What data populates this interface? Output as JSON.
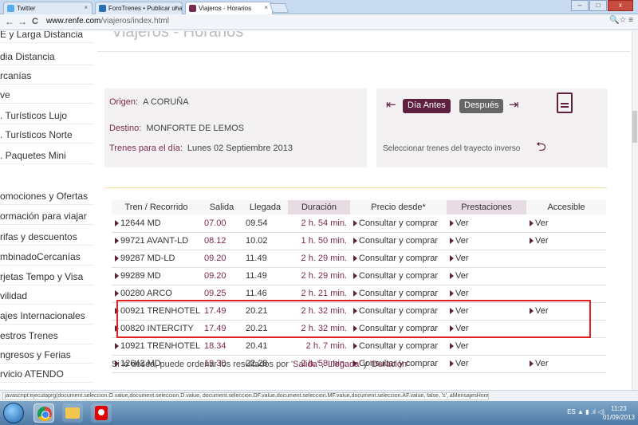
{
  "browser": {
    "tabs": [
      {
        "label": "Twitter",
        "icon": "twitter-icon",
        "color": "#55acee"
      },
      {
        "label": "ForoTrenes • Publicar una",
        "icon": "forum-icon",
        "color": "#2a6fb0"
      },
      {
        "label": "Viajeros - Horarios",
        "icon": "renfe-icon",
        "color": "#7b2a4f"
      }
    ],
    "close_glyph": "×",
    "url_host": "www.renfe.com",
    "url_path": "/viajeros/index.html",
    "back_glyph": "←",
    "forward_glyph": "→",
    "reload_glyph": "C",
    "right_icons": "🔍☆ ≡"
  },
  "page": {
    "heading": "Viajeros - Horarios"
  },
  "sidebar": {
    "items": [
      "E y Larga Distancia",
      "dia Distancia",
      "rcanías",
      "ve",
      ". Turísticos Lujo",
      ". Turísticos Norte",
      ". Paquetes Mini",
      "omociones y Ofertas",
      "ormación para viajar",
      "rifas y descuentos",
      "mbinadoCercanías",
      "rjetas Tempo y Visa",
      "vilidad",
      "ajes Internacionales",
      "estros Trenes",
      "ngresos y Ferias",
      "rvicio ATENDO"
    ]
  },
  "trip": {
    "origin_label": "Origen:",
    "origin": "A CORUÑA",
    "dest_label": "Destino:",
    "dest": "MONFORTE DE LEMOS",
    "date_label": "Trenes para el día:",
    "date": "Lunes  02  Septiembre  2013"
  },
  "daynav": {
    "prev_label": "Día Antes",
    "next_label": "Después",
    "inverse_label": "Seleccionar trenes del trayecto inverso"
  },
  "table": {
    "headers": [
      "Tren / Recorrido",
      "Salida",
      "Llegada",
      "Duración",
      "Precio desde*",
      "Prestaciones",
      "Accesible"
    ],
    "rows": [
      {
        "tren": "12644 MD",
        "salida": "07.00",
        "llegada": "09.54",
        "duracion": "2 h. 54 min.",
        "precio": "Consultar y comprar",
        "prest": "Ver",
        "acc": "Ver"
      },
      {
        "tren": "99721 AVANT-LD",
        "salida": "08.12",
        "llegada": "10.02",
        "duracion": "1 h. 50 min.",
        "precio": "Consultar y comprar",
        "prest": "Ver",
        "acc": "Ver"
      },
      {
        "tren": "99287 MD-LD",
        "salida": "09.20",
        "llegada": "11.49",
        "duracion": "2 h. 29 min.",
        "precio": "Consultar y comprar",
        "prest": "Ver",
        "acc": ""
      },
      {
        "tren": "99289 MD",
        "salida": "09.20",
        "llegada": "11.49",
        "duracion": "2 h. 29 min.",
        "precio": "Consultar y comprar",
        "prest": "Ver",
        "acc": ""
      },
      {
        "tren": "00280 ARCO",
        "salida": "09.25",
        "llegada": "11.46",
        "duracion": "2 h. 21 min.",
        "precio": "Consultar y comprar",
        "prest": "Ver",
        "acc": ""
      },
      {
        "tren": "00921 TRENHOTEL",
        "salida": "17.49",
        "llegada": "20.21",
        "duracion": "2 h. 32 min.",
        "precio": "Consultar y comprar",
        "prest": "Ver",
        "acc": "Ver"
      },
      {
        "tren": "00820 INTERCITY",
        "salida": "17.49",
        "llegada": "20.21",
        "duracion": "2 h. 32 min.",
        "precio": "Consultar y comprar",
        "prest": "Ver",
        "acc": ""
      },
      {
        "tren": "10921 TRENHOTEL",
        "salida": "18.34",
        "llegada": "20.41",
        "duracion": "2 h. 7 min.",
        "precio": "Consultar y comprar",
        "prest": "Ver",
        "acc": ""
      },
      {
        "tren": "12642 MD",
        "salida": "19.30",
        "llegada": "22.28",
        "duracion": "2 h. 58 min.",
        "precio": "Consultar y comprar",
        "prest": "Ver",
        "acc": "Ver"
      }
    ]
  },
  "hint": {
    "prefix": "Si lo desea, puede ordenar los resultados por",
    "k1": "'Salida'",
    "sep1": " , ",
    "k2": "'Llegada'",
    "sep2": " y ",
    "k3": "'Duración'"
  },
  "status_text": "javascript:ejecutaprg(document.seleccion.O.value,document.seleccion.D.value, document.seleccion.DF.value,document.seleccion.MF.value,document.seleccion.AF.value, false, 's', aMensajesHorarios)",
  "taskbar": {
    "tray": "ES  ▲  ▮  .ıl  ◁)",
    "time": "11:23",
    "date": "01/09/2013"
  },
  "colors": {
    "accent": "#7b2a4f",
    "highlight_box": "#e02020"
  }
}
